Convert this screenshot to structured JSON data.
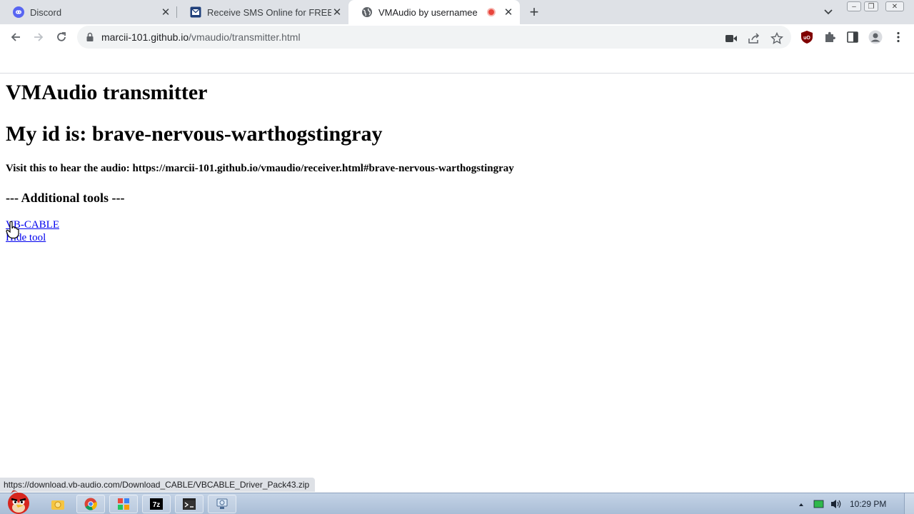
{
  "browser": {
    "tabs": [
      {
        "title": "Discord",
        "active": false
      },
      {
        "title": "Receive SMS Online for FREE |",
        "active": false
      },
      {
        "title": "VMAudio by usernamee",
        "active": true,
        "recording": true
      }
    ],
    "address": {
      "host": "marcii-101.github.io",
      "path": "/vmaudio/transmitter.html"
    }
  },
  "page": {
    "heading": "VMAudio transmitter",
    "id_heading": "My id is: brave-nervous-warthogstingray",
    "visit_text": "Visit this to hear the audio: https://marcii-101.github.io/vmaudio/receiver.html#brave-nervous-warthogstingray",
    "tools_heading": "--- Additional tools ---",
    "links": [
      {
        "label": "VB-CABLE"
      },
      {
        "label": "Hide tool"
      }
    ]
  },
  "status_url": "https://download.vb-audio.com/Download_CABLE/VBCABLE_Driver_Pack43.zip",
  "taskbar": {
    "clock": "10:29 PM"
  },
  "colors": {
    "link": "#0000ee",
    "tabstrip": "#dee1e6",
    "recording": "#e8453c",
    "discord": "#5865f2"
  }
}
